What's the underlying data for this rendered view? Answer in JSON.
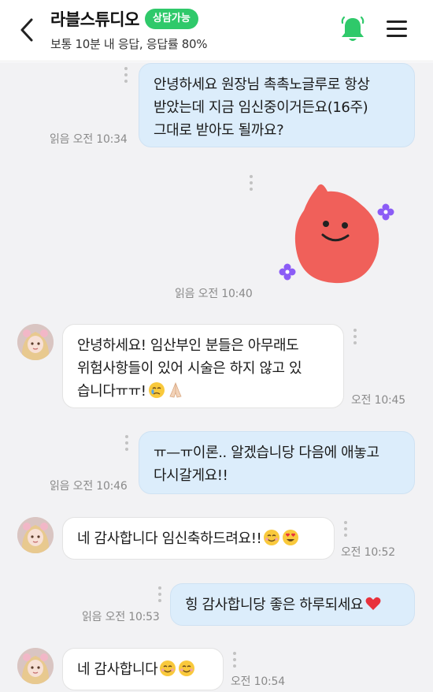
{
  "header": {
    "title": "라블스튜디오",
    "status_badge": "상담가능",
    "subtitle": "보통 10분 내 응답, 응답률 80%",
    "colors": {
      "accent": "#2fc96a",
      "bell": "#2fc96a"
    },
    "icons": [
      "back-arrow-icon",
      "bell-icon",
      "menu-icon"
    ]
  },
  "messages": [
    {
      "from": "me",
      "lines": [
        "안녕하세요 원장님 촉촉노글루로 항상",
        "받았는데 지금 임신중이거든요(16주)",
        "그대로 받아도 될까요?"
      ],
      "read": "읽음",
      "time": "오전 10:34"
    },
    {
      "from": "me",
      "type": "sticker",
      "sticker": "red-blob-smile-sticker",
      "read": "읽음",
      "time": "오전 10:40"
    },
    {
      "from": "them",
      "lines": [
        "안녕하세요! 임산부인 분들은 아무래도",
        "위험사항들이 있어 시술은 하지 않고 있",
        "습니다ㅠㅠ!"
      ],
      "emojis": [
        "crying-face",
        "folded-hands"
      ],
      "time": "오전 10:45"
    },
    {
      "from": "me",
      "lines": [
        "ㅠ—ㅠ이론.. 알겠습니당 다음에 애놓고",
        "다시갈게요!!"
      ],
      "read": "읽음",
      "time": "오전 10:46"
    },
    {
      "from": "them",
      "lines": [
        "네 감사합니다 임신축하드려요!!"
      ],
      "emojis": [
        "smiling-face",
        "heart-eyes-face"
      ],
      "time": "오전 10:52"
    },
    {
      "from": "me",
      "lines": [
        "힝 감사합니당 좋은 하루되세요"
      ],
      "emojis": [
        "red-heart"
      ],
      "read": "읽음",
      "time": "오전 10:53"
    },
    {
      "from": "them",
      "lines": [
        "네 감사합니다"
      ],
      "emojis": [
        "smiling-face",
        "smiling-face"
      ],
      "time": "오전 10:54"
    }
  ],
  "colors": {
    "my_bubble": "#dcedfb",
    "their_bubble": "#ffffff",
    "chat_bg": "#f2f2f4"
  }
}
